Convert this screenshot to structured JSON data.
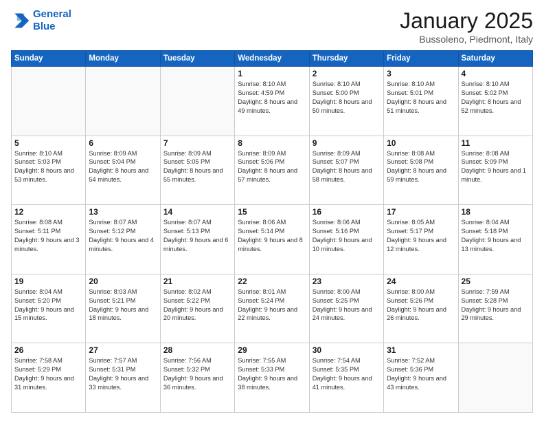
{
  "header": {
    "logo_line1": "General",
    "logo_line2": "Blue",
    "month": "January 2025",
    "location": "Bussoleno, Piedmont, Italy"
  },
  "days_of_week": [
    "Sunday",
    "Monday",
    "Tuesday",
    "Wednesday",
    "Thursday",
    "Friday",
    "Saturday"
  ],
  "weeks": [
    [
      {
        "day": "",
        "info": ""
      },
      {
        "day": "",
        "info": ""
      },
      {
        "day": "",
        "info": ""
      },
      {
        "day": "1",
        "info": "Sunrise: 8:10 AM\nSunset: 4:59 PM\nDaylight: 8 hours\nand 49 minutes."
      },
      {
        "day": "2",
        "info": "Sunrise: 8:10 AM\nSunset: 5:00 PM\nDaylight: 8 hours\nand 50 minutes."
      },
      {
        "day": "3",
        "info": "Sunrise: 8:10 AM\nSunset: 5:01 PM\nDaylight: 8 hours\nand 51 minutes."
      },
      {
        "day": "4",
        "info": "Sunrise: 8:10 AM\nSunset: 5:02 PM\nDaylight: 8 hours\nand 52 minutes."
      }
    ],
    [
      {
        "day": "5",
        "info": "Sunrise: 8:10 AM\nSunset: 5:03 PM\nDaylight: 8 hours\nand 53 minutes."
      },
      {
        "day": "6",
        "info": "Sunrise: 8:09 AM\nSunset: 5:04 PM\nDaylight: 8 hours\nand 54 minutes."
      },
      {
        "day": "7",
        "info": "Sunrise: 8:09 AM\nSunset: 5:05 PM\nDaylight: 8 hours\nand 55 minutes."
      },
      {
        "day": "8",
        "info": "Sunrise: 8:09 AM\nSunset: 5:06 PM\nDaylight: 8 hours\nand 57 minutes."
      },
      {
        "day": "9",
        "info": "Sunrise: 8:09 AM\nSunset: 5:07 PM\nDaylight: 8 hours\nand 58 minutes."
      },
      {
        "day": "10",
        "info": "Sunrise: 8:08 AM\nSunset: 5:08 PM\nDaylight: 8 hours\nand 59 minutes."
      },
      {
        "day": "11",
        "info": "Sunrise: 8:08 AM\nSunset: 5:09 PM\nDaylight: 9 hours\nand 1 minute."
      }
    ],
    [
      {
        "day": "12",
        "info": "Sunrise: 8:08 AM\nSunset: 5:11 PM\nDaylight: 9 hours\nand 3 minutes."
      },
      {
        "day": "13",
        "info": "Sunrise: 8:07 AM\nSunset: 5:12 PM\nDaylight: 9 hours\nand 4 minutes."
      },
      {
        "day": "14",
        "info": "Sunrise: 8:07 AM\nSunset: 5:13 PM\nDaylight: 9 hours\nand 6 minutes."
      },
      {
        "day": "15",
        "info": "Sunrise: 8:06 AM\nSunset: 5:14 PM\nDaylight: 9 hours\nand 8 minutes."
      },
      {
        "day": "16",
        "info": "Sunrise: 8:06 AM\nSunset: 5:16 PM\nDaylight: 9 hours\nand 10 minutes."
      },
      {
        "day": "17",
        "info": "Sunrise: 8:05 AM\nSunset: 5:17 PM\nDaylight: 9 hours\nand 12 minutes."
      },
      {
        "day": "18",
        "info": "Sunrise: 8:04 AM\nSunset: 5:18 PM\nDaylight: 9 hours\nand 13 minutes."
      }
    ],
    [
      {
        "day": "19",
        "info": "Sunrise: 8:04 AM\nSunset: 5:20 PM\nDaylight: 9 hours\nand 15 minutes."
      },
      {
        "day": "20",
        "info": "Sunrise: 8:03 AM\nSunset: 5:21 PM\nDaylight: 9 hours\nand 18 minutes."
      },
      {
        "day": "21",
        "info": "Sunrise: 8:02 AM\nSunset: 5:22 PM\nDaylight: 9 hours\nand 20 minutes."
      },
      {
        "day": "22",
        "info": "Sunrise: 8:01 AM\nSunset: 5:24 PM\nDaylight: 9 hours\nand 22 minutes."
      },
      {
        "day": "23",
        "info": "Sunrise: 8:00 AM\nSunset: 5:25 PM\nDaylight: 9 hours\nand 24 minutes."
      },
      {
        "day": "24",
        "info": "Sunrise: 8:00 AM\nSunset: 5:26 PM\nDaylight: 9 hours\nand 26 minutes."
      },
      {
        "day": "25",
        "info": "Sunrise: 7:59 AM\nSunset: 5:28 PM\nDaylight: 9 hours\nand 29 minutes."
      }
    ],
    [
      {
        "day": "26",
        "info": "Sunrise: 7:58 AM\nSunset: 5:29 PM\nDaylight: 9 hours\nand 31 minutes."
      },
      {
        "day": "27",
        "info": "Sunrise: 7:57 AM\nSunset: 5:31 PM\nDaylight: 9 hours\nand 33 minutes."
      },
      {
        "day": "28",
        "info": "Sunrise: 7:56 AM\nSunset: 5:32 PM\nDaylight: 9 hours\nand 36 minutes."
      },
      {
        "day": "29",
        "info": "Sunrise: 7:55 AM\nSunset: 5:33 PM\nDaylight: 9 hours\nand 38 minutes."
      },
      {
        "day": "30",
        "info": "Sunrise: 7:54 AM\nSunset: 5:35 PM\nDaylight: 9 hours\nand 41 minutes."
      },
      {
        "day": "31",
        "info": "Sunrise: 7:52 AM\nSunset: 5:36 PM\nDaylight: 9 hours\nand 43 minutes."
      },
      {
        "day": "",
        "info": ""
      }
    ]
  ]
}
